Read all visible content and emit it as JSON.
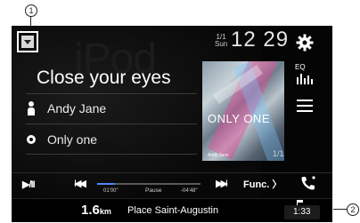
{
  "callouts": [
    "1",
    "2"
  ],
  "header": {
    "source_watermark": "iPod",
    "date_fraction": "1/1",
    "day": "Sun",
    "time": "12 29"
  },
  "track": {
    "title": "Close your eyes",
    "artist": "Andy Jane",
    "album": "Only one",
    "track_count": "1/1"
  },
  "artwork": {
    "title": "ONLY ONE",
    "artist": "Andy Jane"
  },
  "side_buttons": {
    "eq_label": "EQ",
    "settings_icon": "gear-icon",
    "list_icon": "list-icon"
  },
  "controls": {
    "play_pause_label": "▶/II",
    "prev_label": "I◀◀",
    "next_label": "▶▶I",
    "elapsed": "01'00\"",
    "state": "Pause",
    "remaining": "-04'48\"",
    "progress_fraction": 0.17,
    "func_label": "Func. 〉"
  },
  "navigation": {
    "distance_value": "1.6",
    "distance_unit": "km",
    "street": "Place Saint-Augustin",
    "eta": "1:33"
  },
  "colors": {
    "background": "#050505",
    "progress": "#4f86ff",
    "text": "#ffffff"
  }
}
